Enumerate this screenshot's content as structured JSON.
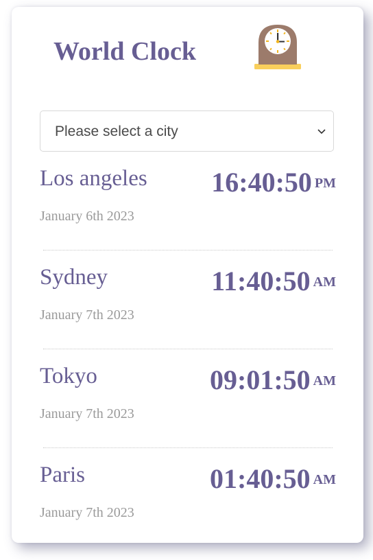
{
  "header": {
    "title": "World Clock",
    "icon": "mantelpiece-clock-icon"
  },
  "city_select": {
    "placeholder": "Please select a city",
    "selected": "Please select a city"
  },
  "cities": [
    {
      "name": "Los angeles",
      "date": "January 6th 2023",
      "time": "16:40:50",
      "ampm": "PM"
    },
    {
      "name": "Sydney",
      "date": "January 7th 2023",
      "time": "11:40:50",
      "ampm": "AM"
    },
    {
      "name": "Tokyo",
      "date": "January 7th 2023",
      "time": "09:01:50",
      "ampm": "AM"
    },
    {
      "name": "Paris",
      "date": "January 7th 2023",
      "time": "01:40:50",
      "ampm": "AM"
    }
  ],
  "colors": {
    "accent": "#675e93",
    "date_text": "#9a9a9a",
    "clock_body": "#9c7b6b",
    "clock_base": "#f9cf5c"
  }
}
